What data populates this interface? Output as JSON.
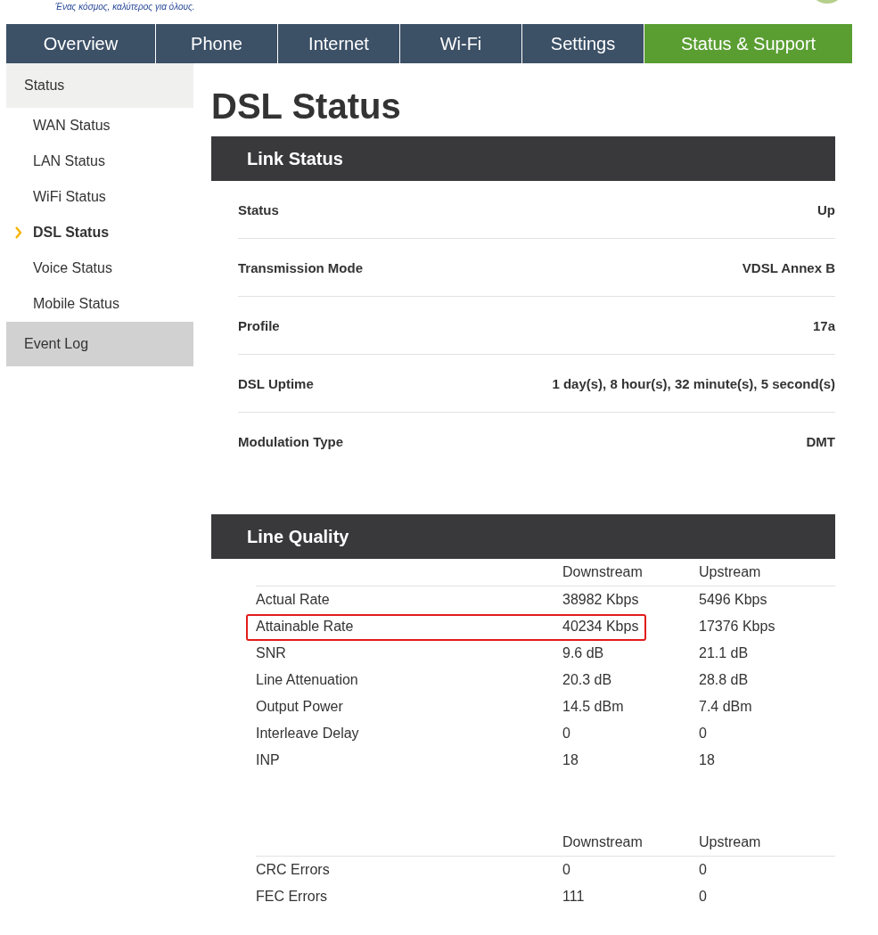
{
  "header": {
    "tagline": "Ένας κόσμος, καλύτερος για όλους."
  },
  "tabs": [
    {
      "label": "Overview",
      "selected": false
    },
    {
      "label": "Phone",
      "selected": false
    },
    {
      "label": "Internet",
      "selected": false
    },
    {
      "label": "Wi-Fi",
      "selected": false
    },
    {
      "label": "Settings",
      "selected": false
    },
    {
      "label": "Status & Support",
      "selected": true
    }
  ],
  "sidebar": {
    "groups": [
      {
        "label": "Status",
        "expanded": true,
        "items": [
          {
            "label": "WAN Status",
            "selected": false
          },
          {
            "label": "LAN Status",
            "selected": false
          },
          {
            "label": "WiFi Status",
            "selected": false
          },
          {
            "label": "DSL Status",
            "selected": true
          },
          {
            "label": "Voice Status",
            "selected": false
          },
          {
            "label": "Mobile Status",
            "selected": false
          }
        ]
      },
      {
        "label": "Event Log",
        "expanded": false
      }
    ]
  },
  "page_title": "DSL Status",
  "link_status": {
    "title": "Link Status",
    "rows": [
      {
        "label": "Status",
        "value": "Up"
      },
      {
        "label": "Transmission Mode",
        "value": "VDSL Annex B"
      },
      {
        "label": "Profile",
        "value": "17a"
      },
      {
        "label": "DSL Uptime",
        "value": "1 day(s), 8 hour(s), 32 minute(s), 5 second(s)"
      },
      {
        "label": "Modulation Type",
        "value": "DMT"
      }
    ]
  },
  "line_quality": {
    "title": "Line Quality",
    "tables": [
      {
        "columns": [
          "Downstream",
          "Upstream"
        ],
        "rows": [
          {
            "label": "Actual Rate",
            "downstream": "38982 Kbps",
            "upstream": "5496 Kbps",
            "highlighted": false
          },
          {
            "label": "Attainable Rate",
            "downstream": "40234 Kbps",
            "upstream": "17376 Kbps",
            "highlighted": true
          },
          {
            "label": "SNR",
            "downstream": "9.6 dB",
            "upstream": "21.1 dB",
            "highlighted": false
          },
          {
            "label": "Line Attenuation",
            "downstream": "20.3 dB",
            "upstream": "28.8 dB",
            "highlighted": false
          },
          {
            "label": "Output Power",
            "downstream": "14.5 dBm",
            "upstream": "7.4 dBm",
            "highlighted": false
          },
          {
            "label": "Interleave Delay",
            "downstream": "0",
            "upstream": "0",
            "highlighted": false
          },
          {
            "label": "INP",
            "downstream": "18",
            "upstream": "18",
            "highlighted": false
          }
        ]
      },
      {
        "columns": [
          "Downstream",
          "Upstream"
        ],
        "rows": [
          {
            "label": "CRC Errors",
            "downstream": "0",
            "upstream": "0",
            "highlighted": false
          },
          {
            "label": "FEC Errors",
            "downstream": "111",
            "upstream": "0",
            "highlighted": false
          }
        ]
      }
    ]
  }
}
